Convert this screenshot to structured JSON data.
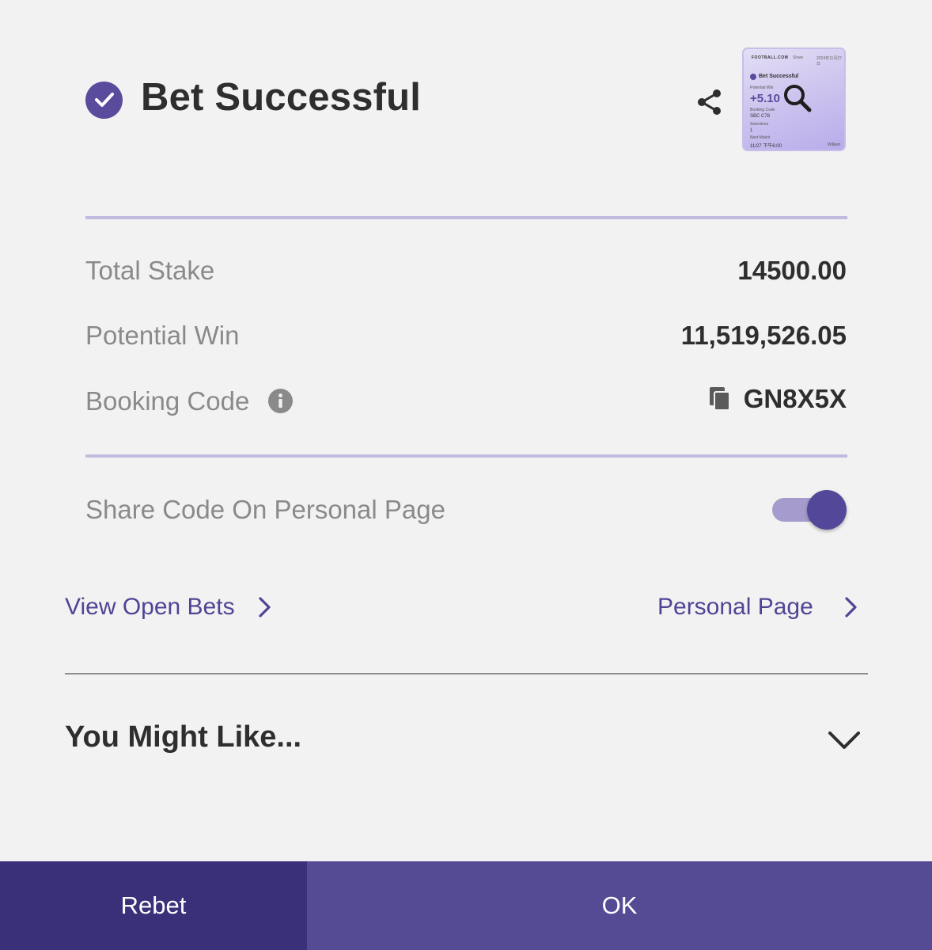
{
  "header": {
    "title": "Bet Successful",
    "status_icon": "check-circle-icon",
    "share_icon": "share-icon"
  },
  "thumbnail": {
    "brand": "FOOTBALL.COM",
    "share": "Share",
    "date": "2024年11月27日",
    "title": "Bet Successful",
    "potential_win_label": "Potential Win",
    "amount": "+5.10",
    "booking_code_label": "Booking Code",
    "booking_code": "SBC C78",
    "selections_label": "Selections",
    "selections": "1",
    "next_match_label": "Next Match",
    "next_match": "11/27 下午6:00",
    "user": "William"
  },
  "summary": {
    "total_stake_label": "Total Stake",
    "total_stake": "14500.00",
    "potential_win_label": "Potential Win",
    "potential_win": "11,519,526.05",
    "booking_code_label": "Booking Code",
    "booking_code": "GN8X5X"
  },
  "share_toggle": {
    "label": "Share Code On Personal Page",
    "on": true
  },
  "links": {
    "view_open_bets": "View Open Bets",
    "personal_page": "Personal Page"
  },
  "recommendations": {
    "title": "You Might Like..."
  },
  "buttons": {
    "rebet": "Rebet",
    "ok": "OK"
  },
  "colors": {
    "accent": "#5b4b9c",
    "rebet_bg": "#3a3079",
    "ok_bg": "#554b95",
    "divider": "#c2bbe0",
    "background": "#f2f2f2"
  }
}
